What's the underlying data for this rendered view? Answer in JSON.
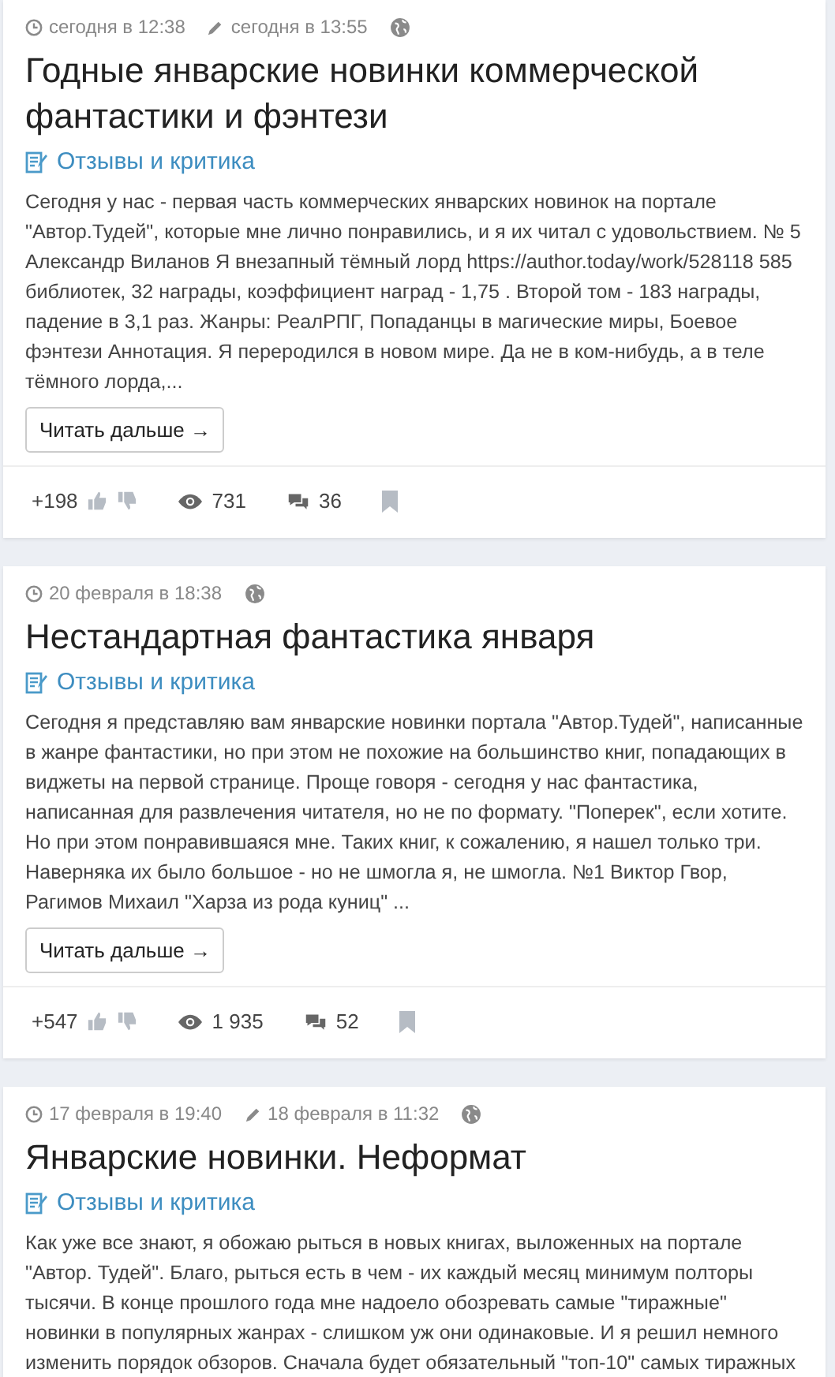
{
  "posts": [
    {
      "created": "сегодня в 12:38",
      "edited": "сегодня в 13:55",
      "title": "Годные январские новинки коммерческой фантастики и фэнтези",
      "category": "Отзывы и критика",
      "excerpt": "Сегодня у нас - первая часть коммерческих январских новинок на портале \"Автор.Тудей\", которые мне лично понравились, и я их читал с удовольствием. № 5 Александр Виланов Я внезапный тёмный лорд https://author.today/work/528118 585 библиотек, 32 награды, коэффициент наград - 1,75 . Второй том - 183 награды, падение в 3,1 раз. Жанры: РеалРПГ, Попаданцы в магические миры, Боевое фэнтези Аннотация. Я переродился в новом мире. Да не в ком-нибудь, а в теле тёмного лорда,...",
      "read_more": "Читать дальше →",
      "rating": "+198",
      "views": "731",
      "comments": "36"
    },
    {
      "created": "20 февраля в 18:38",
      "title": "Нестандартная фантастика января",
      "category": "Отзывы и критика",
      "excerpt": "Сегодня я представляю вам январские новинки портала \"Автор.Тудей\", написанные в жанре фантастики, но при этом не похожие на большинство книг, попадающих в виджеты на первой странице. Проще говоря - сегодня у нас фантастика, написанная для развлечения читателя, но не по формату. \"Поперек\", если хотите. Но при этом понравившаяся мне. Таких книг, к сожалению, я нашел только три. Наверняка их было большое - но не шмогла я, не шмогла. №1 Виктор Гвор, Рагимов Михаил \"Харза из рода куниц\" ...",
      "read_more": "Читать дальше →",
      "rating": "+547",
      "views": "1 935",
      "comments": "52"
    },
    {
      "created": "17 февраля в 19:40",
      "edited": "18 февраля в 11:32",
      "title": "Январские новинки. Неформат",
      "category": "Отзывы и критика",
      "excerpt": "Как уже все знают, я обожаю рыться в новых книгах, выложенных на портале \"Автор. Тудей\". Благо, рыться есть в чем - их каждый месяц минимум полторы тысячи. В конце прошлого года мне надоело обозревать самые \"тиражные\" новинки в популярных жанрах - слишком уж они одинаковые. И я решил немного изменить порядок обзоров. Сначала будет обязательный \"топ-10\" самых тиражных"
    }
  ]
}
